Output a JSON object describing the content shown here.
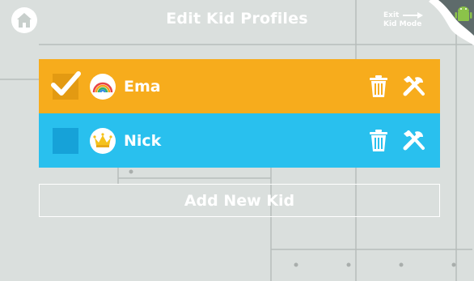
{
  "header": {
    "title": "Edit Kid Profiles",
    "exit_line1": "Exit",
    "exit_line2": "Kid Mode"
  },
  "kids": [
    {
      "name": "Ema",
      "selected": true,
      "avatar": "rainbow-icon",
      "color": "#f7ac1c"
    },
    {
      "name": "Nick",
      "selected": false,
      "avatar": "crown-icon",
      "color": "#29c0ee"
    }
  ],
  "add_button": {
    "label": "Add New Kid"
  },
  "colors": {
    "background": "#dadfdd",
    "selected_row": "#f7ac1c",
    "unselected_row": "#29c0ee",
    "android_green": "#8bc34a"
  }
}
